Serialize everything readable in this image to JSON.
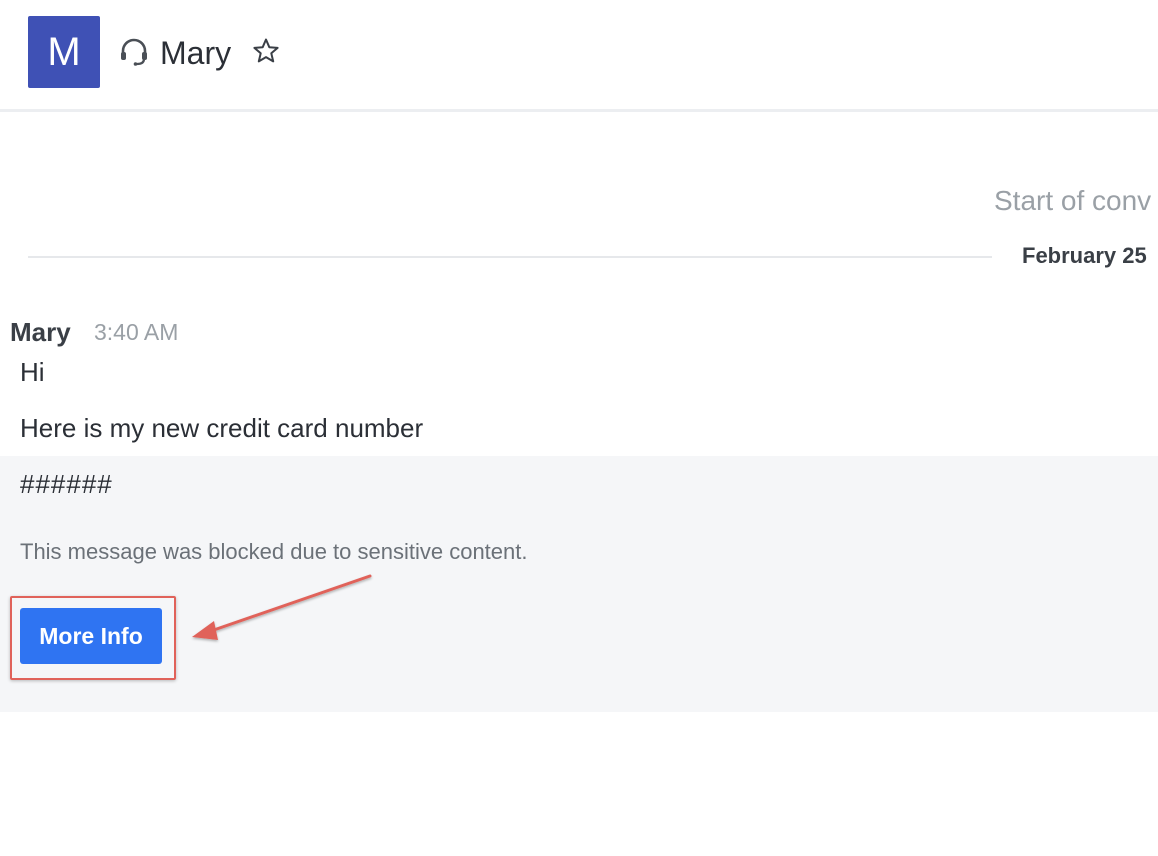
{
  "header": {
    "avatar_letter": "M",
    "contact_name": "Mary",
    "avatar_color": "#3f51b5"
  },
  "conversation": {
    "start_label": "Start of conv",
    "date_label": "February 25"
  },
  "message": {
    "sender": "Mary",
    "time": "3:40 AM",
    "lines": [
      "Hi",
      "Here is my new credit card number"
    ],
    "masked_text": "######",
    "blocked_notice": "This message was blocked due to sensitive content.",
    "more_info_label": "More Info"
  },
  "icons": {
    "headset": "headset-icon",
    "star": "star-icon",
    "arrow": "arrow-annotation"
  },
  "colors": {
    "button": "#2f74f2",
    "highlight": "#e0625a",
    "blocked_bg": "#f5f6f8"
  }
}
